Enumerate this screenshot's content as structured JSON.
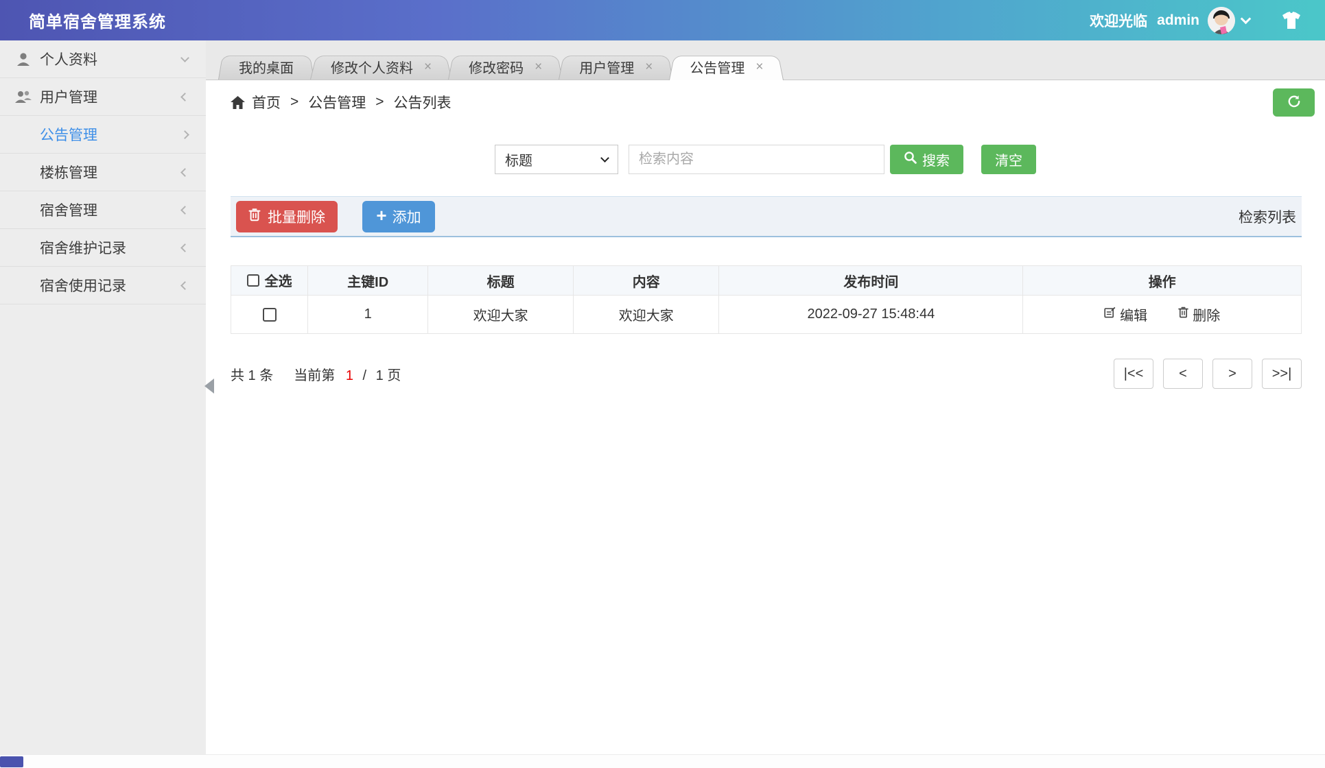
{
  "header": {
    "app_title": "简单宿舍管理系统",
    "welcome_text": "欢迎光临",
    "username": "admin"
  },
  "sidebar": {
    "items": [
      {
        "label": "个人资料",
        "icon": "user-icon",
        "state": "expanded"
      },
      {
        "label": "用户管理",
        "icon": "users-icon",
        "state": "collapsed"
      },
      {
        "label": "公告管理",
        "icon": "menu-list-icon",
        "state": "active"
      },
      {
        "label": "楼栋管理",
        "icon": "menu-list-icon",
        "state": "collapsed"
      },
      {
        "label": "宿舍管理",
        "icon": "menu-list-icon",
        "state": "collapsed"
      },
      {
        "label": "宿舍维护记录",
        "icon": "menu-list-icon",
        "state": "collapsed"
      },
      {
        "label": "宿舍使用记录",
        "icon": "menu-list-icon",
        "state": "collapsed"
      }
    ]
  },
  "tabs": {
    "close_glyph": "×",
    "items": [
      {
        "label": "我的桌面",
        "closable": false,
        "active": false
      },
      {
        "label": "修改个人资料",
        "closable": true,
        "active": false
      },
      {
        "label": "修改密码",
        "closable": true,
        "active": false
      },
      {
        "label": "用户管理",
        "closable": true,
        "active": false
      },
      {
        "label": "公告管理",
        "closable": true,
        "active": true
      }
    ]
  },
  "breadcrumb": {
    "home": "首页",
    "separator": ">",
    "level2": "公告管理",
    "level3": "公告列表"
  },
  "search": {
    "field_select_value": "标题",
    "keyword_placeholder": "检索内容",
    "search_button": "搜索",
    "clear_button": "清空"
  },
  "toolbar": {
    "batch_delete_button": "批量删除",
    "add_button": "添加",
    "list_caption": "检索列表"
  },
  "table": {
    "select_all_label": "全选",
    "columns": [
      "主键ID",
      "标题",
      "内容",
      "发布时间",
      "操作"
    ],
    "edit_label": "编辑",
    "delete_label": "删除",
    "rows": [
      {
        "id": "1",
        "title": "欢迎大家",
        "content": "欢迎大家",
        "publish_time": "2022-09-27 15:48:44"
      }
    ]
  },
  "pagination": {
    "total_text": "共 1 条",
    "current_prefix": "当前第",
    "current_page": "1",
    "divider": "/",
    "total_pages": "1",
    "unit": "页",
    "first_button": "|<<",
    "prev_button": "<",
    "next_button": ">",
    "last_button": ">>|"
  },
  "colors": {
    "header-grad-a": "#4e55b2",
    "header-grad-d": "#4bc7c9",
    "sidebar-active": "#3e8fe8",
    "btn-green": "#5cb85c",
    "btn-red": "#d9534f",
    "btn-blue": "#4f96d8",
    "page-red": "#e80000",
    "scroll-thumb": "#4a53ae"
  }
}
